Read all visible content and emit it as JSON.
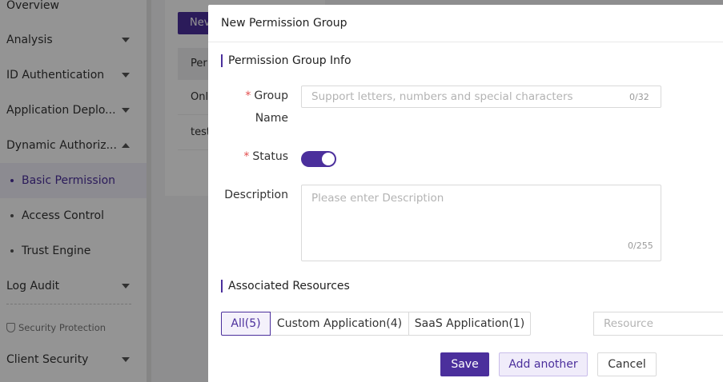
{
  "sidebar": {
    "items": [
      {
        "label": "Overview"
      },
      {
        "label": "Analysis"
      },
      {
        "label": "ID Authentication"
      },
      {
        "label": "Application Deplo..."
      },
      {
        "label": "Dynamic Authoriz..."
      },
      {
        "label": "Log Audit"
      },
      {
        "label": "Client Security"
      }
    ],
    "sub_items": [
      {
        "label": "Basic Permission"
      },
      {
        "label": "Access Control"
      },
      {
        "label": "Trust Engine"
      }
    ],
    "section_label": "Security Protection"
  },
  "background": {
    "new_button": "Nev",
    "table_header": "Per",
    "rows": [
      "Onl",
      "test"
    ]
  },
  "modal": {
    "title": "New Permission Group",
    "info_section": "Permission Group Info",
    "group_name_label_1": "Group",
    "group_name_label_2": "Name",
    "group_name_placeholder": "Support letters, numbers and special characters",
    "group_name_counter": "0/32",
    "status_label": "Status",
    "status_on": true,
    "description_label": "Description",
    "description_placeholder": "Please enter Description",
    "description_counter": "0/255",
    "resources_section": "Associated Resources",
    "resource_tabs": [
      {
        "label": "All(5)",
        "active": true
      },
      {
        "label": "Custom Application(4)",
        "active": false
      },
      {
        "label": "SaaS Application(1)",
        "active": false
      }
    ],
    "resource_placeholder": "Resource",
    "buttons": {
      "save": "Save",
      "add_another": "Add another",
      "cancel": "Cancel"
    }
  },
  "colors": {
    "accent": "#4b2f9c",
    "required": "#e34d4d"
  }
}
